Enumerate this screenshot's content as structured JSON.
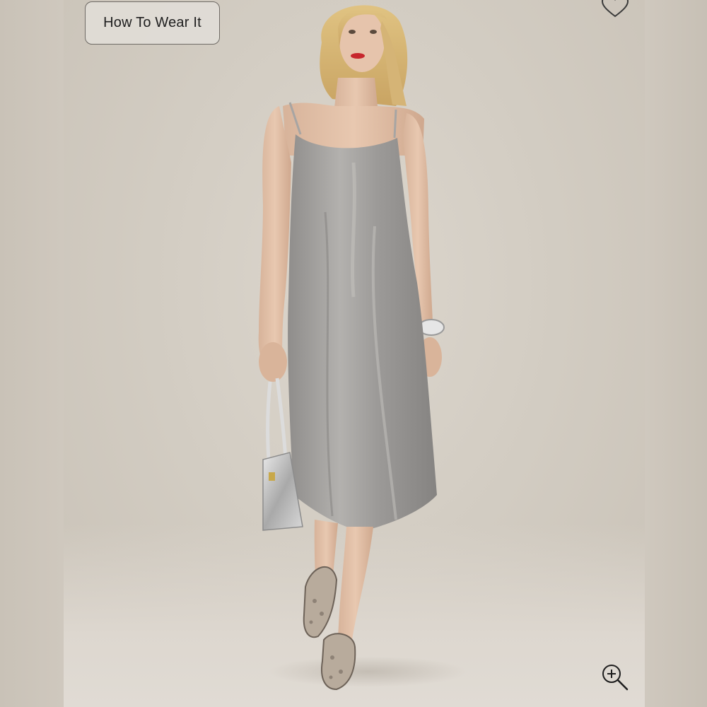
{
  "product_gallery": {
    "how_to_wear_label": "How To Wear It",
    "favorite_icon": "heart-outline-icon",
    "zoom_icon": "zoom-in-icon"
  },
  "colors": {
    "background": "#d5cfc6",
    "dress": "#9a9896",
    "button_border": "#6f6b66"
  }
}
